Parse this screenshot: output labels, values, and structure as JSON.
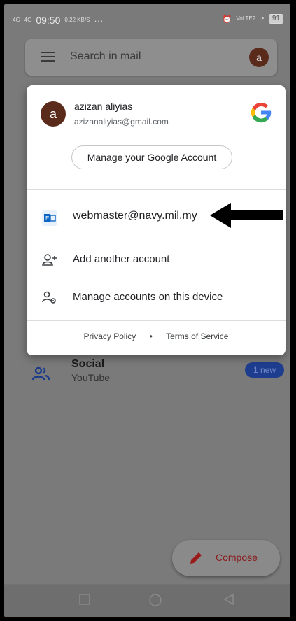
{
  "status_bar": {
    "signal_left": "4G",
    "signal_right": "4G",
    "time": "09:50",
    "speed": "0.22 KB/S",
    "dots": "···",
    "right_net": "VoLTE2",
    "battery": "91"
  },
  "search": {
    "placeholder": "Search in mail",
    "avatar_letter": "a"
  },
  "account_menu": {
    "avatar_letter": "a",
    "name": "azizan aliyias",
    "email": "azizanaliyias@gmail.com",
    "manage_google_account": "Manage your Google Account",
    "exchange_account": "webmaster@navy.mil.my",
    "add_another_account": "Add another account",
    "manage_accounts_device": "Manage accounts on this device",
    "privacy_policy": "Privacy Policy",
    "separator": "•",
    "terms_of_service": "Terms of Service"
  },
  "inbox_category": {
    "title": "Social",
    "subtitle": "YouTube",
    "badge": "1 new"
  },
  "compose": {
    "label": "Compose"
  },
  "colors": {
    "brand_red": "#c5221f",
    "new_badge": "#1e3d8f",
    "exchange_blue": "#0a66c2"
  }
}
